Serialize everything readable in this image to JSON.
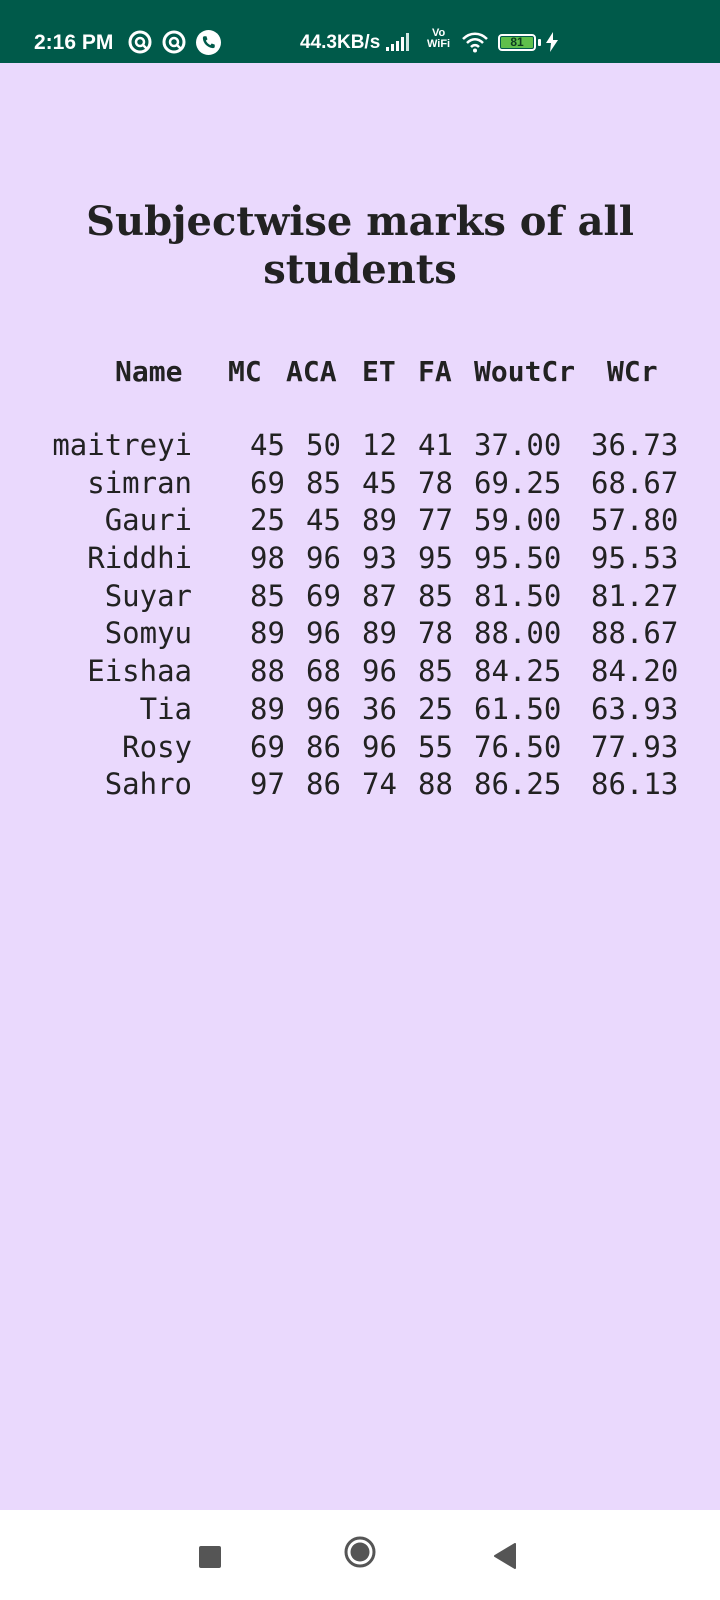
{
  "status_bar": {
    "time": "2:16 PM",
    "network_speed": "44.3KB/s",
    "vowifi_top": "Vo",
    "vowifi_bottom": "WiFi",
    "battery_level": "81",
    "background_color": "#005a4a",
    "icons": [
      "location-icon",
      "location-icon",
      "phone-icon",
      "signal-icon",
      "wifi-icon",
      "battery-icon",
      "charging-icon"
    ]
  },
  "page": {
    "title": "Subjectwise marks of all students",
    "background_color": "#ead9fd"
  },
  "marks": {
    "headers": {
      "name": "Name",
      "mc": "MC",
      "aca": "ACA",
      "et": "ET",
      "fa": "FA",
      "wout": "WoutCr",
      "wcr": "WCr"
    },
    "rows": [
      {
        "name": "maitreyi",
        "mc": "45",
        "aca": "50",
        "et": "12",
        "fa": "41",
        "wout": "37.00",
        "wcr": "36.73"
      },
      {
        "name": "simran",
        "mc": "69",
        "aca": "85",
        "et": "45",
        "fa": "78",
        "wout": "69.25",
        "wcr": "68.67"
      },
      {
        "name": "Gauri",
        "mc": "25",
        "aca": "45",
        "et": "89",
        "fa": "77",
        "wout": "59.00",
        "wcr": "57.80"
      },
      {
        "name": "Riddhi",
        "mc": "98",
        "aca": "96",
        "et": "93",
        "fa": "95",
        "wout": "95.50",
        "wcr": "95.53"
      },
      {
        "name": "Suyar",
        "mc": "85",
        "aca": "69",
        "et": "87",
        "fa": "85",
        "wout": "81.50",
        "wcr": "81.27"
      },
      {
        "name": "Somyu",
        "mc": "89",
        "aca": "96",
        "et": "89",
        "fa": "78",
        "wout": "88.00",
        "wcr": "88.67"
      },
      {
        "name": "Eishaa",
        "mc": "88",
        "aca": "68",
        "et": "96",
        "fa": "85",
        "wout": "84.25",
        "wcr": "84.20"
      },
      {
        "name": "Tia",
        "mc": "89",
        "aca": "96",
        "et": "36",
        "fa": "25",
        "wout": "61.50",
        "wcr": "63.93"
      },
      {
        "name": "Rosy",
        "mc": "69",
        "aca": "86",
        "et": "96",
        "fa": "55",
        "wout": "76.50",
        "wcr": "77.93"
      },
      {
        "name": "Sahro",
        "mc": "97",
        "aca": "86",
        "et": "74",
        "fa": "88",
        "wout": "86.25",
        "wcr": "86.13"
      }
    ]
  },
  "nav_bar": {
    "buttons": [
      "recents-button",
      "home-button",
      "back-button"
    ]
  }
}
